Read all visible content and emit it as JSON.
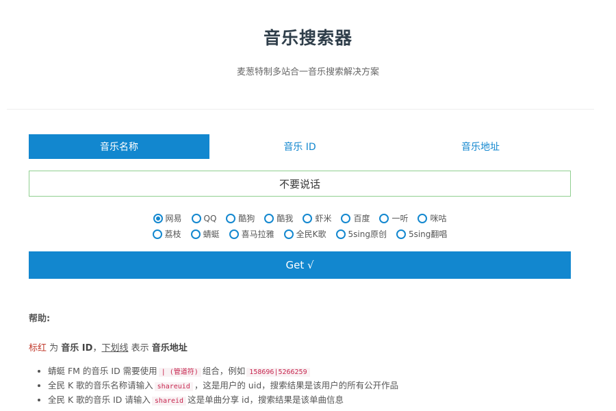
{
  "header": {
    "title": "音乐搜索器",
    "subtitle": "麦葱特制多站合一音乐搜索解决方案"
  },
  "tabs": [
    {
      "label": "音乐名称",
      "active": true
    },
    {
      "label": "音乐 ID",
      "active": false
    },
    {
      "label": "音乐地址",
      "active": false
    }
  ],
  "search": {
    "value": "不要说话"
  },
  "sources": {
    "row1": [
      {
        "label": "网易",
        "checked": true
      },
      {
        "label": "QQ",
        "checked": false
      },
      {
        "label": "酷狗",
        "checked": false
      },
      {
        "label": "酷我",
        "checked": false
      },
      {
        "label": "虾米",
        "checked": false
      },
      {
        "label": "百度",
        "checked": false
      },
      {
        "label": "一听",
        "checked": false
      },
      {
        "label": "咪咕",
        "checked": false
      }
    ],
    "row2": [
      {
        "label": "荔枝",
        "checked": false
      },
      {
        "label": "蜻蜓",
        "checked": false
      },
      {
        "label": "喜马拉雅",
        "checked": false
      },
      {
        "label": "全民K歌",
        "checked": false
      },
      {
        "label": "5sing原创",
        "checked": false
      },
      {
        "label": "5sing翻唱",
        "checked": false
      }
    ]
  },
  "button": {
    "label": "Get √"
  },
  "help": {
    "title": "帮助:",
    "legend": {
      "red": "标红",
      "t1": " 为 ",
      "music_id": "音乐 ID",
      "t2": "，",
      "underline": "下划线",
      "t3": " 表示 ",
      "music_url": "音乐地址"
    },
    "notes": [
      {
        "t1": "蜻蜓 FM 的音乐 ID 需要使用",
        "code1": "| (管道符)",
        "t2": "组合，例如",
        "code2": "158696|5266259",
        "t3": ""
      },
      {
        "t1": "全民 K 歌的音乐名称请输入",
        "code1": "shareuid",
        "t2": "，这是用户的 uid，搜索结果是该用户的所有公开作品"
      },
      {
        "t1": "全民 K 歌的音乐 ID 请输入",
        "code1": "shareid",
        "t2": "这是单曲分享 id，搜索结果是该单曲信息"
      }
    ]
  },
  "colors": {
    "accent": "#1287cf",
    "input_border": "#8fcf8f",
    "code": "#c7254e"
  }
}
